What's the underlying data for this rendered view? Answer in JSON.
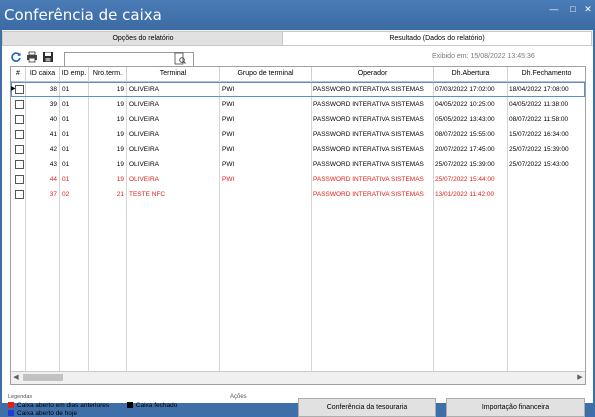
{
  "window": {
    "title": "Conferência de caixa"
  },
  "tabs": [
    {
      "label": "Opções do relatório"
    },
    {
      "label": "Resultado (Dados do relatório)"
    }
  ],
  "search": {
    "value": ""
  },
  "exibido_em": "Exibido em: 15/08/2022 13:45:36",
  "columns": [
    {
      "label": "#"
    },
    {
      "label": "ID caixa"
    },
    {
      "label": "ID emp."
    },
    {
      "label": "Nro.term."
    },
    {
      "label": "Terminal"
    },
    {
      "label": "Grupo de terminal"
    },
    {
      "label": "Operador"
    },
    {
      "label": "Dh.Abertura"
    },
    {
      "label": "Dh.Fechamento"
    }
  ],
  "rows": [
    {
      "id_caixa": "38",
      "id_emp": "01",
      "nro_term": "19",
      "terminal": "OLIVEIRA",
      "grupo": "PWI",
      "operador": "PASSWORD INTERATIVA SISTEMAS",
      "abertura": "07/03/2022 17:02:00",
      "fechamento": "18/04/2022 17:08:00",
      "color": "#000000"
    },
    {
      "id_caixa": "39",
      "id_emp": "01",
      "nro_term": "19",
      "terminal": "OLIVEIRA",
      "grupo": "PWI",
      "operador": "PASSWORD INTERATIVA SISTEMAS",
      "abertura": "04/05/2022 10:25:00",
      "fechamento": "04/05/2022 11:38:00",
      "color": "#000000"
    },
    {
      "id_caixa": "40",
      "id_emp": "01",
      "nro_term": "19",
      "terminal": "OLIVEIRA",
      "grupo": "PWI",
      "operador": "PASSWORD INTERATIVA SISTEMAS",
      "abertura": "05/05/2022 13:43:00",
      "fechamento": "08/07/2022 11:58:00",
      "color": "#000000"
    },
    {
      "id_caixa": "41",
      "id_emp": "01",
      "nro_term": "19",
      "terminal": "OLIVEIRA",
      "grupo": "PWI",
      "operador": "PASSWORD INTERATIVA SISTEMAS",
      "abertura": "08/07/2022 15:55:00",
      "fechamento": "15/07/2022 16:34:00",
      "color": "#000000"
    },
    {
      "id_caixa": "42",
      "id_emp": "01",
      "nro_term": "19",
      "terminal": "OLIVEIRA",
      "grupo": "PWI",
      "operador": "PASSWORD INTERATIVA SISTEMAS",
      "abertura": "20/07/2022 17:45:00",
      "fechamento": "25/07/2022 15:39:00",
      "color": "#000000"
    },
    {
      "id_caixa": "43",
      "id_emp": "01",
      "nro_term": "19",
      "terminal": "OLIVEIRA",
      "grupo": "PWI",
      "operador": "PASSWORD INTERATIVA SISTEMAS",
      "abertura": "25/07/2022 15:39:00",
      "fechamento": "25/07/2022 15:43:00",
      "color": "#000000"
    },
    {
      "id_caixa": "44",
      "id_emp": "01",
      "nro_term": "19",
      "terminal": "OLIVEIRA",
      "grupo": "PWI",
      "operador": "PASSWORD INTERATIVA SISTEMAS",
      "abertura": "25/07/2022 15:44:00",
      "fechamento": "",
      "color": "#e0201c"
    },
    {
      "id_caixa": "37",
      "id_emp": "02",
      "nro_term": "21",
      "terminal": "TESTE NFC",
      "grupo": "",
      "operador": "PASSWORD INTERATIVA SISTEMAS",
      "abertura": "13/01/2022 11:42:00",
      "fechamento": "",
      "color": "#e0201c"
    }
  ],
  "legend": {
    "title": "Legendas",
    "items": [
      {
        "label": "Caixa aberto em dias anteriores",
        "color": "#e0201c"
      },
      {
        "label": "Caixa fechado",
        "color": "#000000"
      },
      {
        "label": "Caixa aberto de hoje",
        "color": "#1c3fd6"
      }
    ]
  },
  "actions": {
    "title": "Ações",
    "conferencia_label": "Conferência da tesouraria",
    "importacao_label": "Importação financeira"
  }
}
